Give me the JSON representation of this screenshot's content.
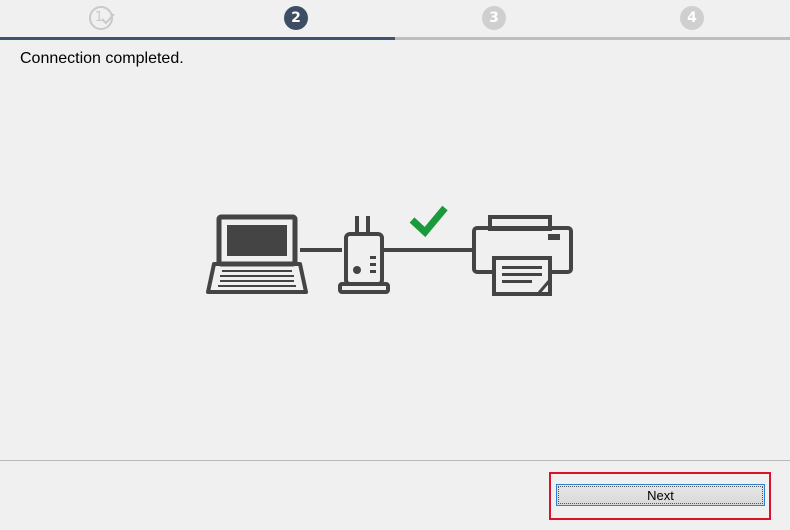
{
  "steps": [
    {
      "label": "1",
      "state": "done"
    },
    {
      "label": "2",
      "state": "current"
    },
    {
      "label": "3",
      "state": "pending"
    },
    {
      "label": "4",
      "state": "pending"
    }
  ],
  "message": "Connection completed.",
  "colors": {
    "active_step": "#3d4e64",
    "pending_step": "#cfcfcf",
    "checkmark": "#1a9a3a",
    "device_stroke": "#444444",
    "highlight": "#d9142a"
  },
  "diagram": {
    "icons": [
      "laptop-icon",
      "router-icon",
      "checkmark-icon",
      "printer-icon"
    ]
  },
  "buttons": {
    "next_label": "Next"
  }
}
